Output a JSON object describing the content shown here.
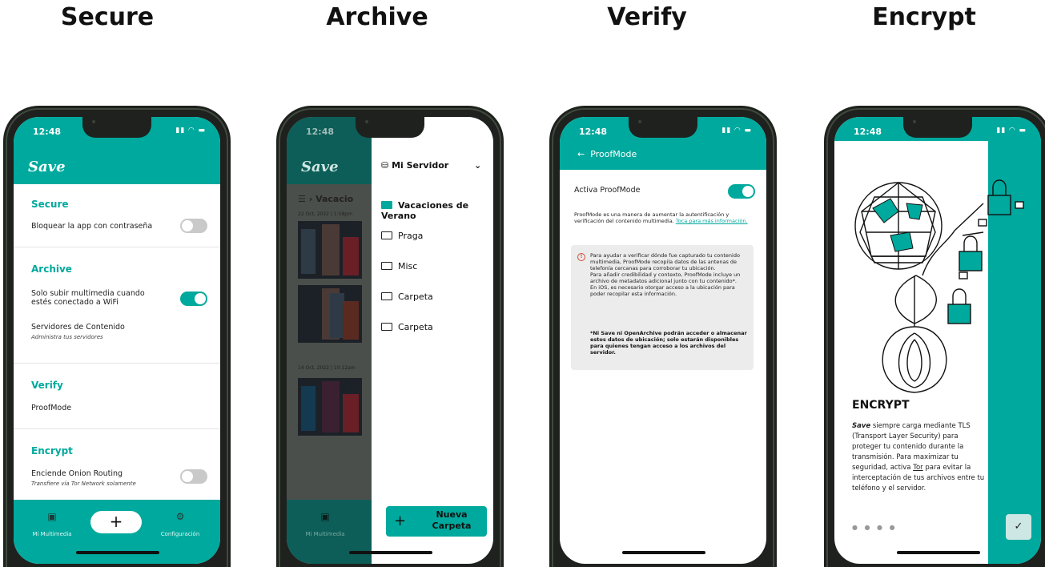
{
  "titles": [
    "Secure",
    "Archive",
    "Verify",
    "Encrypt"
  ],
  "colors": {
    "accent": "#00a99d",
    "dark_accent": "#0d5e58",
    "warning": "#d34b34"
  },
  "status_time": "12:48",
  "p1": {
    "logo": "Save",
    "secure": {
      "title": "Secure",
      "lock_label": "Bloquear la app con contraseña",
      "lock_on": false
    },
    "archive": {
      "title": "Archive",
      "wifi_line1": "Solo subir multimedia cuando",
      "wifi_line2": "estés conectado a WiFi",
      "wifi_on": true,
      "servers_label": "Servidores de Contenido",
      "servers_sub": "Administra tus servidores"
    },
    "verify": {
      "title": "Verify",
      "proofmode": "ProofMode"
    },
    "encrypt": {
      "title": "Encrypt",
      "onion_label": "Enciende Onion Routing",
      "onion_sub": "Transfiere vía Tor Network solamente",
      "onion_on": false
    },
    "nav": {
      "media": "Mi Multimedia",
      "add": "+",
      "settings": "Configuración"
    }
  },
  "p2": {
    "logo": "Save",
    "server": "Mi Servidor",
    "crumb": "Vacacio",
    "date1": "22 Oct, 2022 | 1:58pm",
    "date2": "14 Oct, 2022 | 10:12am",
    "folders": [
      "Vacaciones de Verano",
      "Praga",
      "Misc",
      "Carpeta",
      "Carpeta"
    ],
    "new_folder": "Nueva Carpeta",
    "nav_media": "Mi Multimedia"
  },
  "p3": {
    "back": "←",
    "title": "ProofMode",
    "activate": "Activa ProofMode",
    "activate_on": true,
    "desc": "ProofMode es una manera de aumentar la autentificación y verificación del contenido multimedia.",
    "desc_link": "Toca para más información.",
    "info": "Para ayudar a verificar dónde fue capturado tu contenido multimedia, ProofMode recopila datos de las antenas de telefonía cercanas para corroborar tu ubicación.\n Para añadir credibilidad y contexto, ProofMode incluye un archivo de metadatos adicional junto con tu contenido*.\n En iOS, es necesario otorgar acceso a la ubicación para poder recopilar esta información.",
    "info_bold": "*Ni Save ni OpenArchive podrán acceder o almacenar estos datos de ubicación; solo estarán disponibles para quienes tengan acceso a los archivos del servidor."
  },
  "p4": {
    "title": "ENCRYPT",
    "body_lead": "Save",
    "body_1": " siempre carga mediante TLS (Transport Layer Security) para proteger tu contenido durante la transmisión. Para maximizar tu seguridad, activa ",
    "body_link": "Tor",
    "body_2": " para evitar la interceptación de tus archivos entre tu teléfono y el servidor.",
    "dots": "● ● ● ●",
    "check": "✓"
  }
}
